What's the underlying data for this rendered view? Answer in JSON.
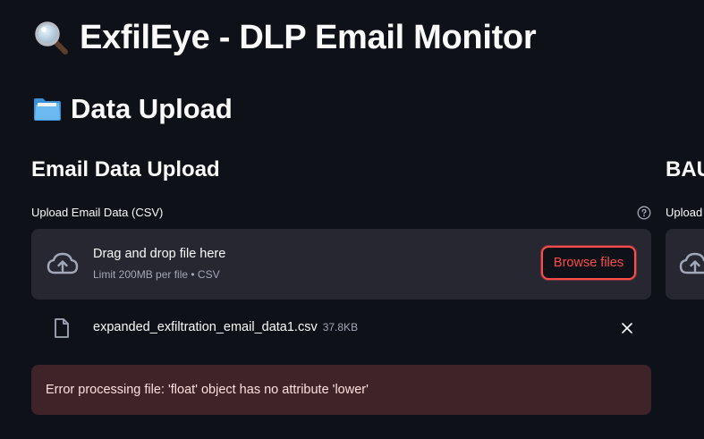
{
  "app": {
    "title": "ExfilEye - DLP Email Monitor",
    "title_icon": "magnifier-emoji",
    "section_title": "Data Upload",
    "section_icon": "folder-emoji"
  },
  "email_upload": {
    "subheader": "Email Data Upload",
    "label": "Upload Email Data (CSV)",
    "dropzone_primary": "Drag and drop file here",
    "dropzone_secondary": "Limit 200MB per file • CSV",
    "browse_label": "Browse files",
    "file": {
      "name": "expanded_exfiltration_email_data1.csv",
      "size": "37.8KB"
    },
    "error": "Error processing file: 'float' object has no attribute 'lower'"
  },
  "bau_upload": {
    "subheader": "BAU",
    "label": "Upload"
  },
  "colors": {
    "background": "#0e1117",
    "dropzone": "#262730",
    "accent": "#ff4b4b",
    "error_bg": "#3e2428",
    "muted_text": "#a3a8b8"
  }
}
